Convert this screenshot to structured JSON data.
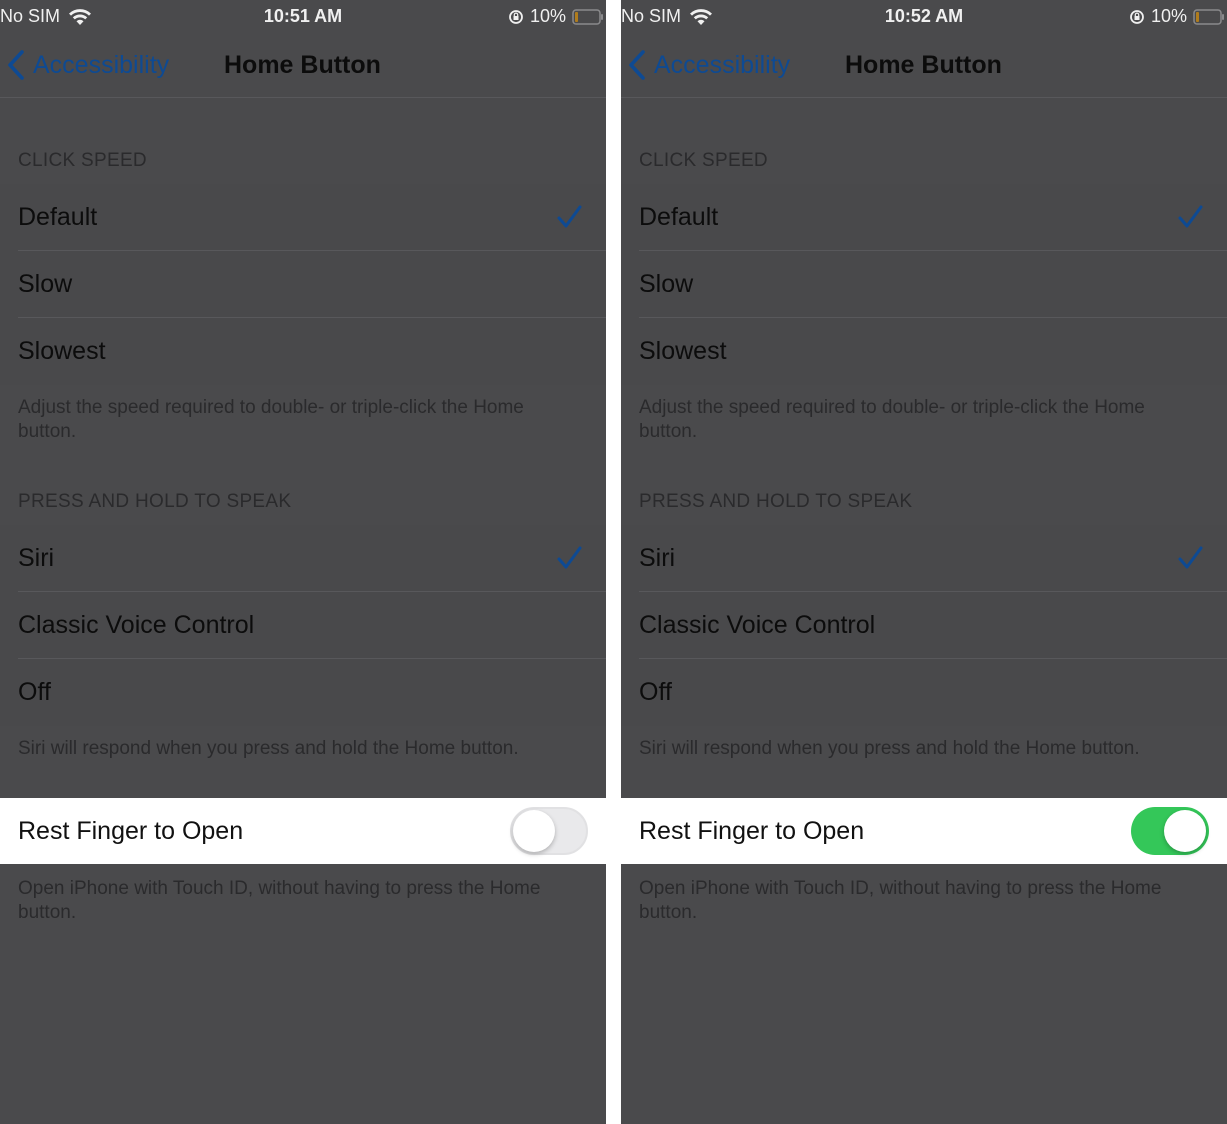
{
  "colors": {
    "accent_blue": "#0e4a93",
    "toggle_on_green": "#34c759",
    "toggle_off_gray": "#e9e9eb",
    "dimmed_background": "#4a4a4c"
  },
  "screens": [
    {
      "status": {
        "carrier": "No SIM",
        "time": "10:51 AM",
        "battery": "10%"
      },
      "nav": {
        "back_label": "Accessibility",
        "title": "Home Button"
      },
      "click_speed": {
        "header": "CLICK SPEED",
        "options": [
          "Default",
          "Slow",
          "Slowest"
        ],
        "selected": "Default",
        "footer": "Adjust the speed required to double- or triple-click the Home button."
      },
      "press_hold": {
        "header": "PRESS AND HOLD TO SPEAK",
        "options": [
          "Siri",
          "Classic Voice Control",
          "Off"
        ],
        "selected": "Siri",
        "footer": "Siri will respond when you press and hold the Home button."
      },
      "rest_finger": {
        "label": "Rest Finger to Open",
        "enabled": false,
        "footer": "Open iPhone with Touch ID, without having to press the Home button."
      }
    },
    {
      "status": {
        "carrier": "No SIM",
        "time": "10:52 AM",
        "battery": "10%"
      },
      "nav": {
        "back_label": "Accessibility",
        "title": "Home Button"
      },
      "click_speed": {
        "header": "CLICK SPEED",
        "options": [
          "Default",
          "Slow",
          "Slowest"
        ],
        "selected": "Default",
        "footer": "Adjust the speed required to double- or triple-click the Home button."
      },
      "press_hold": {
        "header": "PRESS AND HOLD TO SPEAK",
        "options": [
          "Siri",
          "Classic Voice Control",
          "Off"
        ],
        "selected": "Siri",
        "footer": "Siri will respond when you press and hold the Home button."
      },
      "rest_finger": {
        "label": "Rest Finger to Open",
        "enabled": true,
        "footer": "Open iPhone with Touch ID, without having to press the Home button."
      }
    }
  ]
}
